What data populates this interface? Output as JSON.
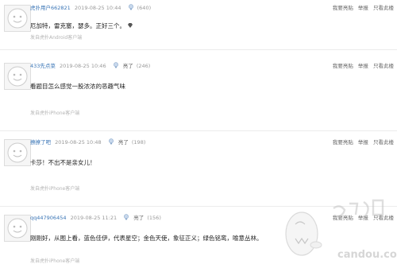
{
  "replies": [
    {
      "user": "虎扑用户662821",
      "time": "2019-08-25 10:44",
      "light_count": "(640)",
      "content": "厄加特，雷克塞，瑟多。正好三个。",
      "source": "发自虎扑Android客户端",
      "actions": [
        "我要亮贴",
        "举报",
        "只看此楼"
      ]
    },
    {
      "user": "433先点菜",
      "time": "2019-08-25 10:46",
      "light_label": "亮了",
      "light_count": "(246)",
      "content": "看题目怎么感觉一股浓浓的恶趣气味",
      "source": "发自虎扑iPhone客户端",
      "actions": [
        "我要亮贴",
        "举报",
        "只看此楼"
      ]
    },
    {
      "user": "撩撩了吧",
      "time": "2019-08-25 10:48",
      "light_label": "亮了",
      "light_count": "(198)",
      "content": "卡莎！不出不是亲女儿！",
      "source": "发自虎扑iPhone客户端",
      "actions": [
        "我要亮贴",
        "举报",
        "只看此楼"
      ]
    },
    {
      "user": "qq447906454",
      "time": "2019-08-25 11:21",
      "light_label": "亮了",
      "light_count": "(156)",
      "content": "刚刚好，从图上看，蓝色佳伊，代表星空；金色天使，象征正义；绿色铭鸾，喻意丛林。",
      "source": "发自虎扑iPhone客户端",
      "actions": [
        "我要亮贴",
        "举报",
        "只看此楼"
      ]
    }
  ],
  "watermark": {
    "url": "candou.com"
  },
  "colors": {
    "username": "#3a75b6",
    "meta": "#999999",
    "source": "#b5b5b5"
  }
}
